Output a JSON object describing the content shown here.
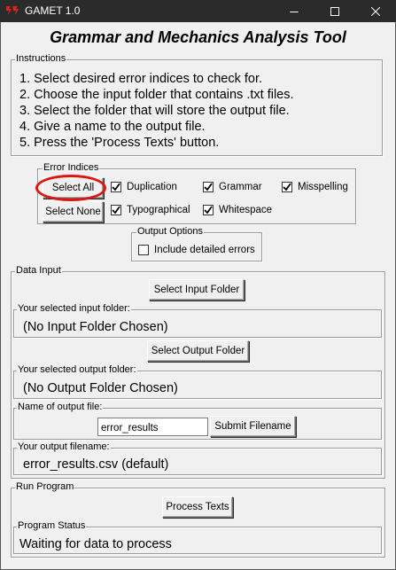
{
  "window": {
    "title": "GAMET 1.0",
    "minimize_icon": "minimize-icon",
    "maximize_icon": "maximize-icon",
    "close_icon": "close-icon"
  },
  "heading": "Grammar and Mechanics Analysis Tool",
  "instructions": {
    "label": "Instructions",
    "lines": [
      "1. Select desired error indices to check for.",
      "2. Choose the input folder that contains .txt files.",
      "3. Select the folder that will store the output file.",
      "4. Give a name to the output file.",
      "5. Press the 'Process Texts' button."
    ]
  },
  "error_indices": {
    "label": "Error Indices",
    "select_all": "Select All",
    "select_none": "Select None",
    "options": [
      {
        "label": "Duplication",
        "checked": true
      },
      {
        "label": "Grammar",
        "checked": true
      },
      {
        "label": "Misspelling",
        "checked": true
      },
      {
        "label": "Typographical",
        "checked": true
      },
      {
        "label": "Whitespace",
        "checked": true
      }
    ]
  },
  "output_options": {
    "label": "Output Options",
    "detailed_errors": {
      "label": "Include detailed errors",
      "checked": false
    }
  },
  "data_input": {
    "label": "Data Input",
    "select_input_button": "Select Input Folder",
    "input_folder_label": "Your selected input folder:",
    "input_folder_value": "(No Input Folder Chosen)",
    "select_output_button": "Select Output Folder",
    "output_folder_label": "Your selected output folder:",
    "output_folder_value": "(No Output Folder Chosen)",
    "filename_label": "Name of output file:",
    "filename_value": "error_results",
    "submit_button": "Submit Filename",
    "output_filename_label": "Your output filename:",
    "output_filename_value": "error_results.csv (default)"
  },
  "run_program": {
    "label": "Run Program",
    "process_button": "Process Texts",
    "status_label": "Program Status",
    "status_value": "Waiting for data to process"
  },
  "colors": {
    "titlebar": "#2b2b2b",
    "background": "#f0f0f0",
    "annotation": "#e01313"
  }
}
